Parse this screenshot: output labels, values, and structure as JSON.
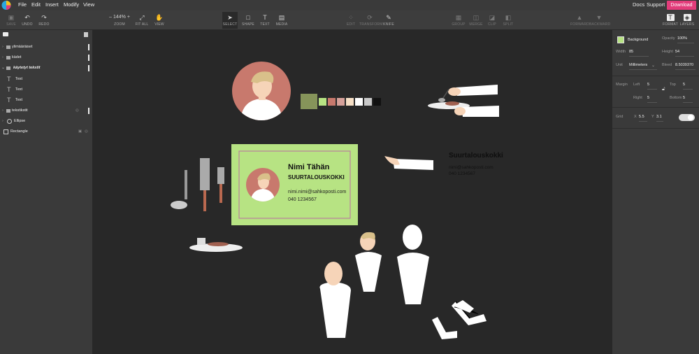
{
  "menu": {
    "items": [
      "File",
      "Edit",
      "Insert",
      "Modify",
      "View"
    ],
    "docs": "Docs",
    "support": "Support",
    "download": "Download"
  },
  "toolbar": {
    "save": "SAVE",
    "undo": "UNDO",
    "redo": "REDO",
    "zoom_value": "144%",
    "zoom": "ZOOM",
    "fit_all": "FIT ALL",
    "view": "VIEW",
    "select": "SELECT",
    "shape": "SHAPE",
    "text": "TEXT",
    "media": "MEDIA",
    "edit": "EDIT",
    "transform": "TRANSFORM",
    "knife": "KNIFE",
    "group": "GROUP",
    "merge": "MERGE",
    "clip": "CLIP",
    "split": "SPLIT",
    "forward": "FORWARD",
    "backward": "BACKWARD",
    "format": "FORMAT",
    "layers": "LAYERS"
  },
  "layers": [
    {
      "label": "ylimääräiset"
    },
    {
      "label": "kädet"
    },
    {
      "label": "käytetyt tekstit"
    },
    {
      "label": "Text"
    },
    {
      "label": "Text"
    },
    {
      "label": "Text"
    },
    {
      "label": "tekstikstit"
    },
    {
      "label": "Ellipse"
    },
    {
      "label": "Rectangle"
    }
  ],
  "format": {
    "background": "Background",
    "opacity_label": "Opacity",
    "opacity": "100%",
    "width_label": "Width",
    "width": "85",
    "height_label": "Height",
    "height": "54",
    "unit_label": "Unit",
    "unit": "Millimeters",
    "bleed_label": "Bleed",
    "bleed": "8.5039370",
    "margin_label": "Margin",
    "left_label": "Left",
    "left": "5",
    "top_label": "Top",
    "top": "5",
    "right_label": "Right",
    "right": "5",
    "bottom_label": "Bottom",
    "bottom": "5",
    "grid_label": "Grid",
    "x_label": "X",
    "x": "5.5",
    "y_label": "Y",
    "y": "3.1"
  },
  "card": {
    "name": "Nimi Tähän",
    "title": "SUURTALOUSKOKKI",
    "email": "nimi.nimi@sahkoposti.com",
    "phone": "040 1234567"
  },
  "loose_text": {
    "title": "Suurtalouskokki",
    "email": "nimi@sahkoposti.com",
    "phone": "040 1234567"
  },
  "colors": {
    "accent": "#e23c7a",
    "card_bg": "#b7e383",
    "card_border": "#b86ea0",
    "swatches": [
      "#86945a",
      "#b7e383",
      "#c8796d",
      "#d6a19a",
      "#f6dfc6",
      "#ffffff",
      "#c9c9c9",
      "#111111"
    ]
  }
}
